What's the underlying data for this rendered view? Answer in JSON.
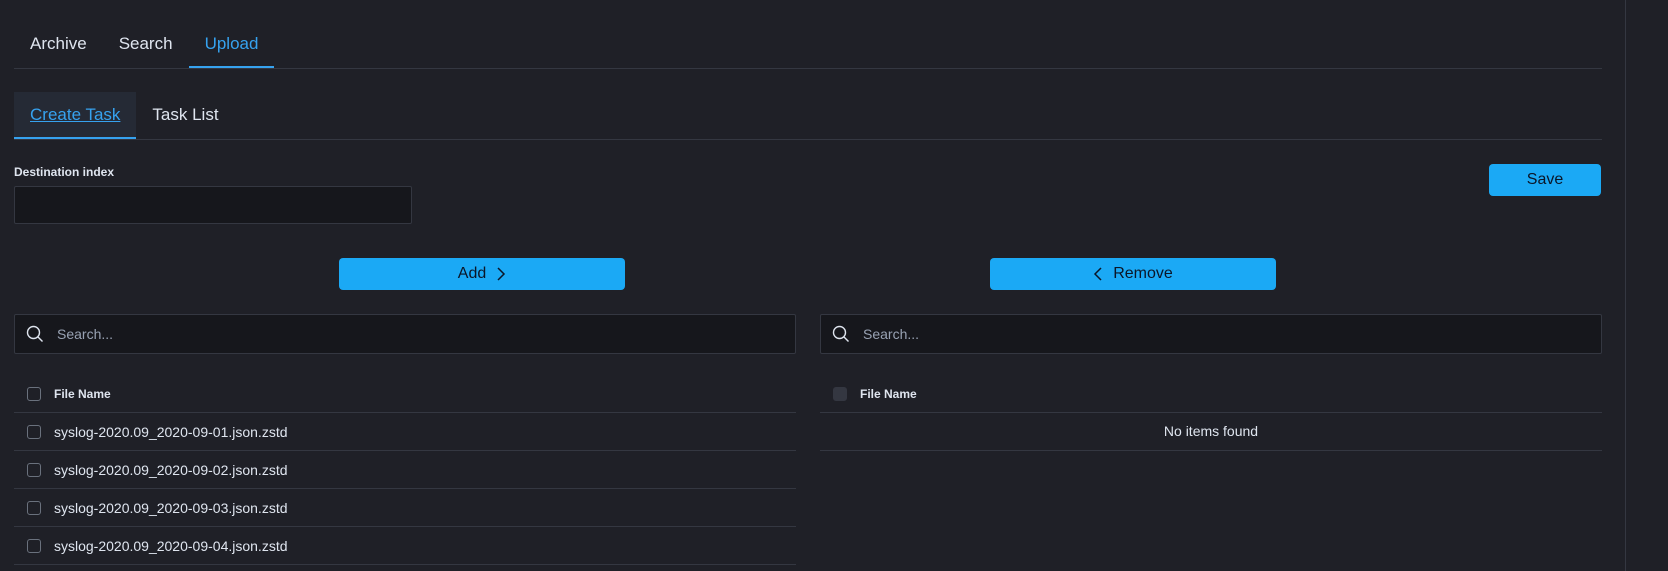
{
  "top_tabs": [
    {
      "label": "Archive"
    },
    {
      "label": "Search"
    },
    {
      "label": "Upload"
    }
  ],
  "top_tabs_active": "Upload",
  "sub_tabs": [
    {
      "label": "Create Task"
    },
    {
      "label": "Task List"
    }
  ],
  "sub_tabs_active": "Create Task",
  "form": {
    "destination_label": "Destination index",
    "destination_value": "",
    "save_label": "Save"
  },
  "transfer": {
    "add_label": "Add",
    "remove_label": "Remove"
  },
  "left_list": {
    "search_placeholder": "Search...",
    "column_header": "File Name",
    "rows": [
      "syslog-2020.09_2020-09-01.json.zstd",
      "syslog-2020.09_2020-09-02.json.zstd",
      "syslog-2020.09_2020-09-03.json.zstd",
      "syslog-2020.09_2020-09-04.json.zstd"
    ]
  },
  "right_list": {
    "search_placeholder": "Search...",
    "column_header": "File Name",
    "empty_message": "No items found"
  },
  "colors": {
    "accent": "#36a2ef",
    "button": "#1ba9f5",
    "background": "#1f2027"
  }
}
